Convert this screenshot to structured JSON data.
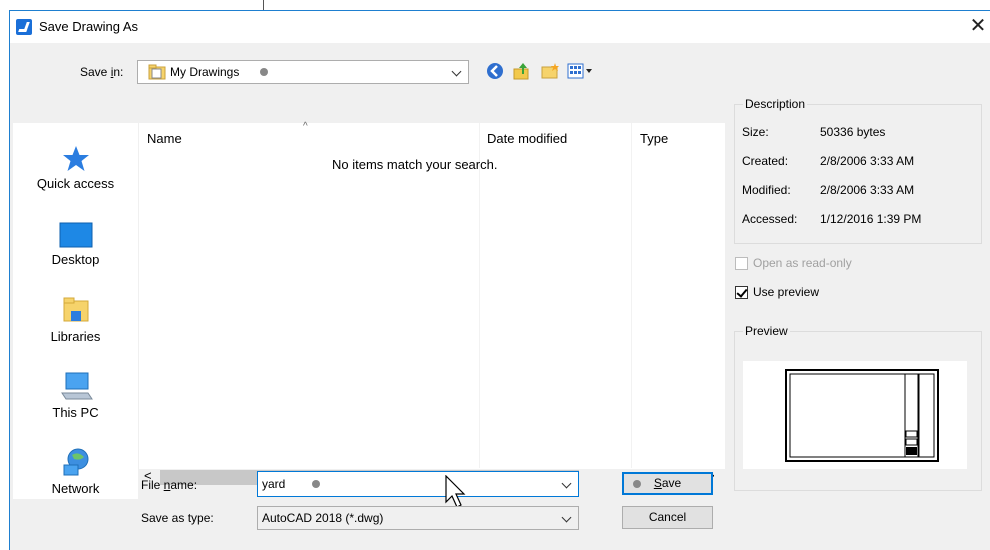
{
  "window": {
    "title": "Save Drawing As",
    "close_glyph": "✕"
  },
  "save_in": {
    "label_pre": "Save ",
    "label_key": "i",
    "label_post": "n:",
    "value": "My Drawings"
  },
  "toolbar_icons": [
    "back-icon",
    "up-folder-icon",
    "new-folder-icon",
    "view-menu-icon"
  ],
  "places": [
    {
      "label": "Quick access",
      "icon": "star-icon"
    },
    {
      "label": "Desktop",
      "icon": "desktop-icon"
    },
    {
      "label": "Libraries",
      "icon": "libraries-icon"
    },
    {
      "label": "This PC",
      "icon": "computer-icon"
    },
    {
      "label": "Network",
      "icon": "network-icon"
    }
  ],
  "file_list": {
    "columns": [
      "Name",
      "Date modified",
      "Type"
    ],
    "empty_message": "No items match your search."
  },
  "file_name": {
    "label_pre": "File ",
    "label_key": "n",
    "label_post": "ame:",
    "value": "yard"
  },
  "save_type": {
    "label": "Save as type:",
    "value": "AutoCAD 2018 (*.dwg)"
  },
  "buttons": {
    "save_key": "S",
    "save_rest": "ave",
    "cancel": "Cancel"
  },
  "description": {
    "title": "Description",
    "rows": [
      {
        "label": "Size:",
        "value": "50336 bytes"
      },
      {
        "label": "Created:",
        "value": "2/8/2006 3:33 AM"
      },
      {
        "label": "Modified:",
        "value": "2/8/2006 3:33 AM"
      },
      {
        "label": "Accessed:",
        "value": "1/12/2016 1:39 PM"
      }
    ]
  },
  "options": {
    "open_read_only": {
      "label": "Open as read-only",
      "checked": false,
      "enabled": false
    },
    "use_preview": {
      "label": "Use preview",
      "checked": true,
      "enabled": true
    }
  },
  "preview": {
    "title": "Preview"
  },
  "colors": {
    "accent": "#0078d7",
    "window_bg": "#f0f0f0",
    "title_border": "#1e7fd0"
  }
}
